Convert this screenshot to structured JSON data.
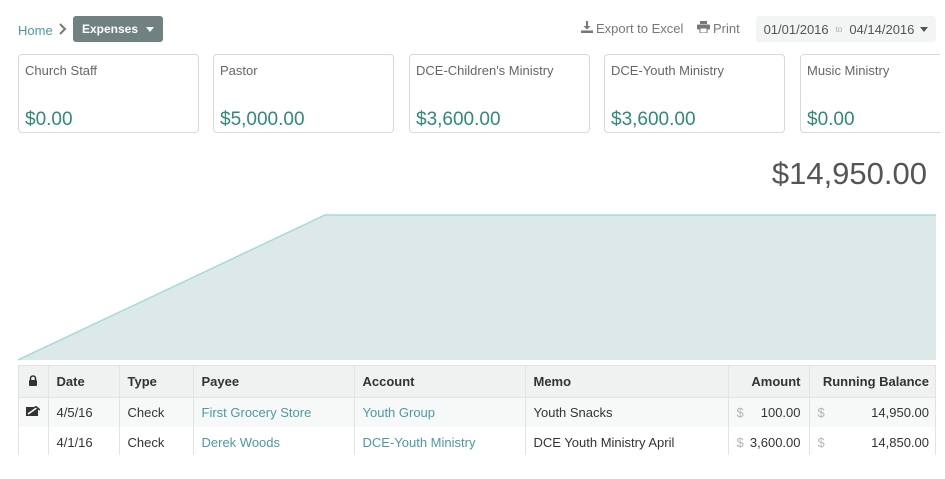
{
  "breadcrumb": {
    "home": "Home",
    "current": "Expenses"
  },
  "toolbar": {
    "export_label": "Export to Excel",
    "print_label": "Print",
    "date_from": "01/01/2016",
    "date_to_sep": "to",
    "date_to": "04/14/2016"
  },
  "cards": [
    {
      "title": "Church Staff",
      "amount": "$0.00"
    },
    {
      "title": "Pastor",
      "amount": "$5,000.00"
    },
    {
      "title": "DCE-Children's Ministry",
      "amount": "$3,600.00"
    },
    {
      "title": "DCE-Youth Ministry",
      "amount": "$3,600.00"
    },
    {
      "title": "Music Ministry",
      "amount": "$0.00"
    }
  ],
  "total": "$14,950.00",
  "chart_data": {
    "type": "area",
    "series": [
      {
        "values": [
          0,
          14950,
          14950
        ]
      }
    ],
    "ylim": [
      0,
      14950
    ],
    "grid": false,
    "colors": {
      "fill": "#dde9e9",
      "stroke": "#9fdcdc"
    }
  },
  "table": {
    "headers": {
      "lock": "",
      "date": "Date",
      "type": "Type",
      "payee": "Payee",
      "account": "Account",
      "memo": "Memo",
      "amount": "Amount",
      "balance": "Running Balance"
    },
    "currency": "$",
    "rows": [
      {
        "date": "4/5/16",
        "type": "Check",
        "payee": "First Grocery Store",
        "account": "Youth Group",
        "memo": "Youth Snacks",
        "amount": "100.00",
        "balance": "14,950.00",
        "icon": "reconciled-icon"
      },
      {
        "date": "4/1/16",
        "type": "Check",
        "payee": "Derek Woods",
        "account": "DCE-Youth Ministry",
        "memo": "DCE Youth Ministry April",
        "amount": "3,600.00",
        "balance": "14,850.00",
        "icon": ""
      }
    ]
  },
  "colors": {
    "accent": "#4a9aa6",
    "amount_green": "#2e8a7a",
    "button": "#6f8180"
  }
}
